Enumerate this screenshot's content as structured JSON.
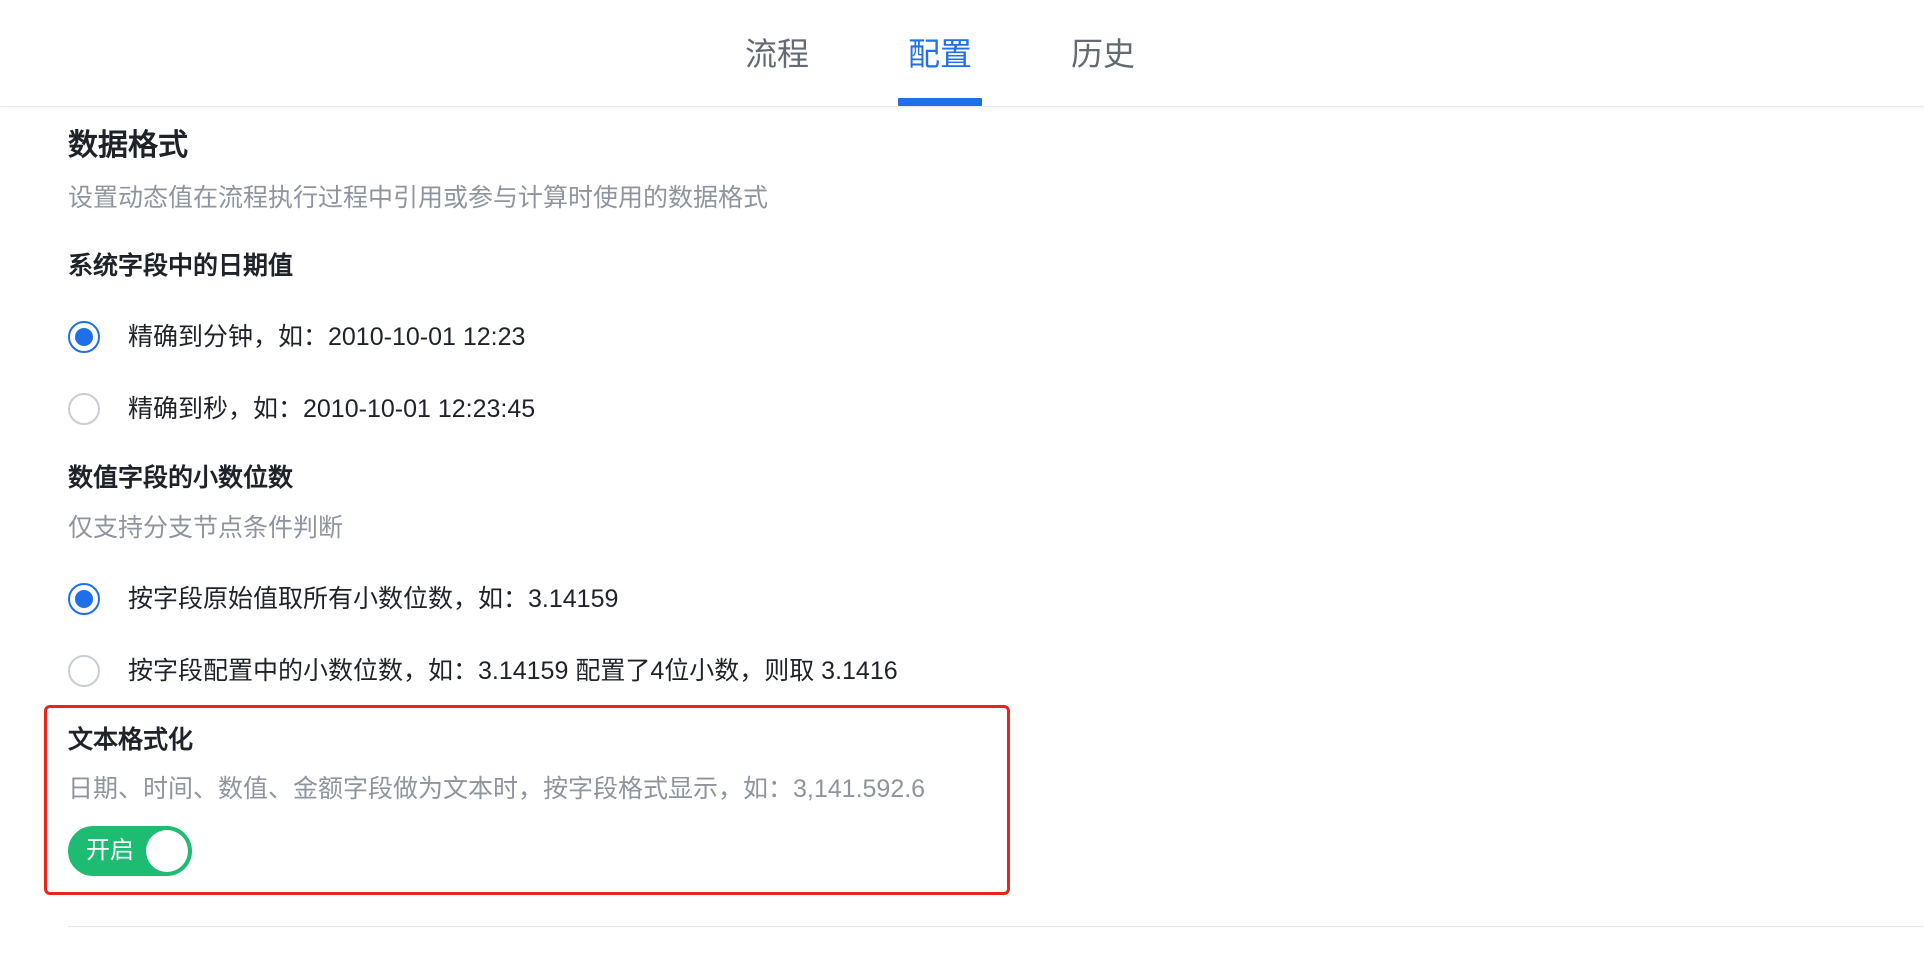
{
  "tabs": [
    {
      "label": "流程",
      "active": false
    },
    {
      "label": "配置",
      "active": true
    },
    {
      "label": "历史",
      "active": false
    }
  ],
  "section": {
    "title": "数据格式",
    "description": "设置动态值在流程执行过程中引用或参与计算时使用的数据格式"
  },
  "date_group": {
    "title": "系统字段中的日期值",
    "options": [
      {
        "label": "精确到分钟，如：2010-10-01 12:23",
        "checked": true
      },
      {
        "label": "精确到秒，如：2010-10-01 12:23:45",
        "checked": false
      }
    ]
  },
  "decimal_group": {
    "title": "数值字段的小数位数",
    "description": "仅支持分支节点条件判断",
    "options": [
      {
        "label": "按字段原始值取所有小数位数，如：3.14159",
        "checked": true
      },
      {
        "label": "按字段配置中的小数位数，如：3.14159 配置了4位小数，则取 3.1416",
        "checked": false
      }
    ]
  },
  "text_format": {
    "title": "文本格式化",
    "description": "日期、时间、数值、金额字段做为文本时，按字段格式显示，如：3,141.592.6",
    "toggle_label": "开启",
    "enabled": true
  },
  "colors": {
    "accent": "#1e6fe8",
    "toggle_on": "#1ebb73",
    "highlight": "#e8241d"
  }
}
